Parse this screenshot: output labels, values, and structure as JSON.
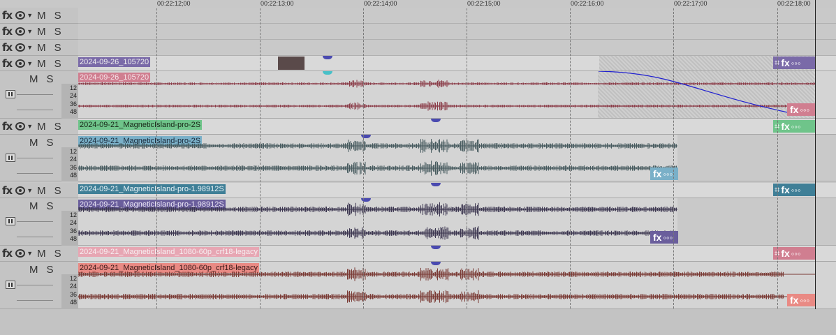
{
  "ruler": {
    "ticks": [
      "00:22:12;00",
      "00:22:13;00",
      "00:22:14;00",
      "00:22:15;00",
      "00:22:16;00",
      "00:22:17;00",
      "00:22:18;00"
    ]
  },
  "header_labels": {
    "fx": "fx",
    "mute": "M",
    "solo": "S",
    "db_12": "12",
    "db_24": "24",
    "db_36": "36",
    "db_48": "48"
  },
  "tracks": {
    "t4_video": "2024-09-26_105720",
    "t4_audio": "2024-09-26_105720",
    "t5_video": "2024-09-21_MagneticIsland-pro-2S",
    "t5_audio": "2024-09-21_MagneticIsland-pro-2S",
    "t6_video": "2024-09-21_MagneticIsland-pro-1.98912S",
    "t6_audio": "2024-09-21_MagneticIsland-pro-1.98912S",
    "t7_video": "2024-09-21_MagneticIsland_1080-60p_crf18-legacy",
    "t7_audio": "2024-09-21_MagneticIsland_1080-60p_crf18-legacy"
  },
  "clip_buttons": {
    "fx": "fx",
    "more": "◦◦◦"
  },
  "colors": {
    "purple": "#7a6aa8",
    "pink": "#d07e90",
    "green": "#6fc48a",
    "blue": "#7ab0c8",
    "teal": "#3f7f97",
    "violet": "#6a5e9c",
    "salmon": "#e98a84",
    "pink_light": "#e7a6b3"
  },
  "icons": [
    "fx-icon",
    "eye-icon",
    "dropdown-icon",
    "mute-icon",
    "solo-icon",
    "crop-icon",
    "more-icon",
    "fader-icon"
  ]
}
